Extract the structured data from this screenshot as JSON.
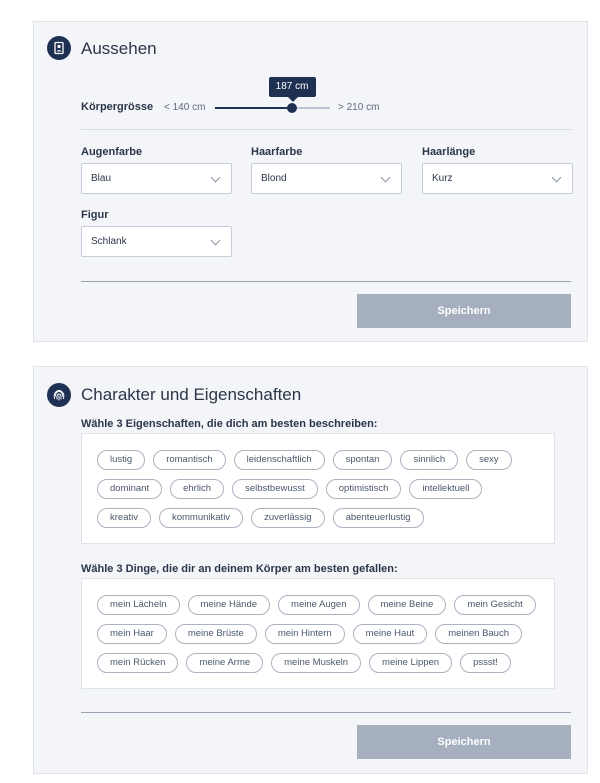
{
  "appearance": {
    "title": "Aussehen",
    "icon": "person-icon",
    "height_label": "Körpergrösse",
    "height_min": "< 140 cm",
    "height_max": "> 210 cm",
    "height_value": "187 cm",
    "height_fraction": 0.67,
    "eye_label": "Augenfarbe",
    "eye_value": "Blau",
    "hair_color_label": "Haarfarbe",
    "hair_color_value": "Blond",
    "hair_length_label": "Haarlänge",
    "hair_length_value": "Kurz",
    "figure_label": "Figur",
    "figure_value": "Schlank",
    "save_label": "Speichern"
  },
  "character": {
    "title": "Charakter und Eigenschaften",
    "icon": "fingerprint-icon",
    "traits_prompt": "Wähle 3 Eigenschaften, die dich am besten beschreiben:",
    "traits": [
      "lustig",
      "romantisch",
      "leidenschaftlich",
      "spontan",
      "sinnlich",
      "sexy",
      "dominant",
      "ehrlich",
      "selbstbewusst",
      "optimistisch",
      "intellektuell",
      "kreativ",
      "kommunikativ",
      "zuverlässig",
      "abenteuerlustig"
    ],
    "body_prompt": "Wähle 3 Dinge, die dir an deinem Körper am besten gefallen:",
    "body": [
      "mein Lächeln",
      "meine Hände",
      "meine Augen",
      "meine Beine",
      "mein Gesicht",
      "mein Haar",
      "meine Brüste",
      "mein Hintern",
      "meine Haut",
      "meinen Bauch",
      "mein Rücken",
      "meine Arme",
      "meine Muskeln",
      "meine Lippen",
      "pssst!"
    ],
    "save_label": "Speichern"
  }
}
